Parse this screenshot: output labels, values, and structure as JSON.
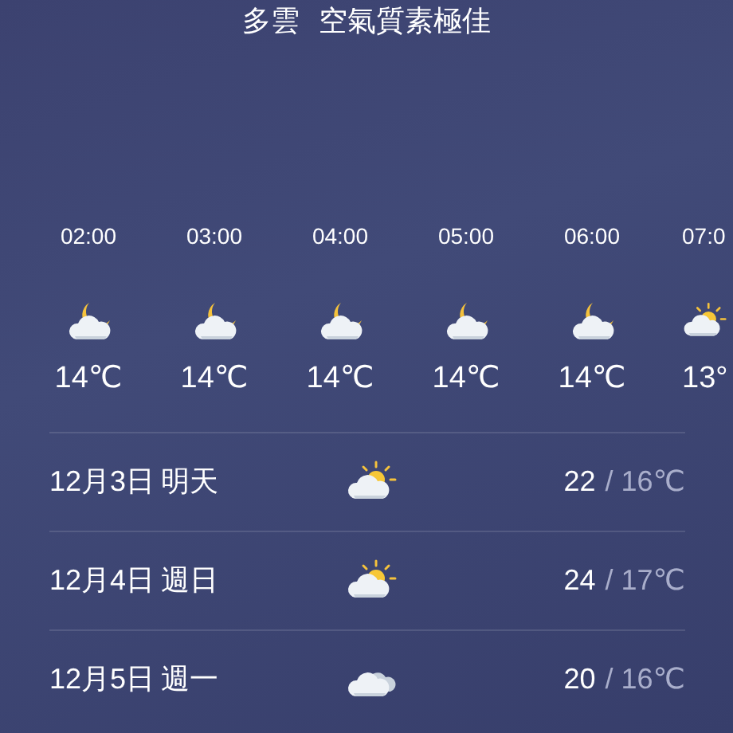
{
  "summary": {
    "condition": "多雲",
    "air_quality": "空氣質素極佳"
  },
  "hourly": [
    {
      "time": "02:00",
      "kind": "moon-cloud",
      "temp": "14℃"
    },
    {
      "time": "03:00",
      "kind": "moon-cloud",
      "temp": "14℃"
    },
    {
      "time": "04:00",
      "kind": "moon-cloud",
      "temp": "14℃"
    },
    {
      "time": "05:00",
      "kind": "moon-cloud",
      "temp": "14℃"
    },
    {
      "time": "06:00",
      "kind": "moon-cloud",
      "temp": "14℃"
    },
    {
      "time": "07:0",
      "kind": "sun-cloud",
      "temp": "13°"
    }
  ],
  "daily": [
    {
      "date": "12月3日",
      "day": "明天",
      "kind": "sun-cloud",
      "high": "22",
      "low": "/ 16℃"
    },
    {
      "date": "12月4日",
      "day": "週日",
      "kind": "sun-cloud",
      "high": "24",
      "low": "/ 17℃"
    },
    {
      "date": "12月5日",
      "day": "週一",
      "kind": "cloud",
      "high": "20",
      "low": "/ 16℃"
    }
  ]
}
